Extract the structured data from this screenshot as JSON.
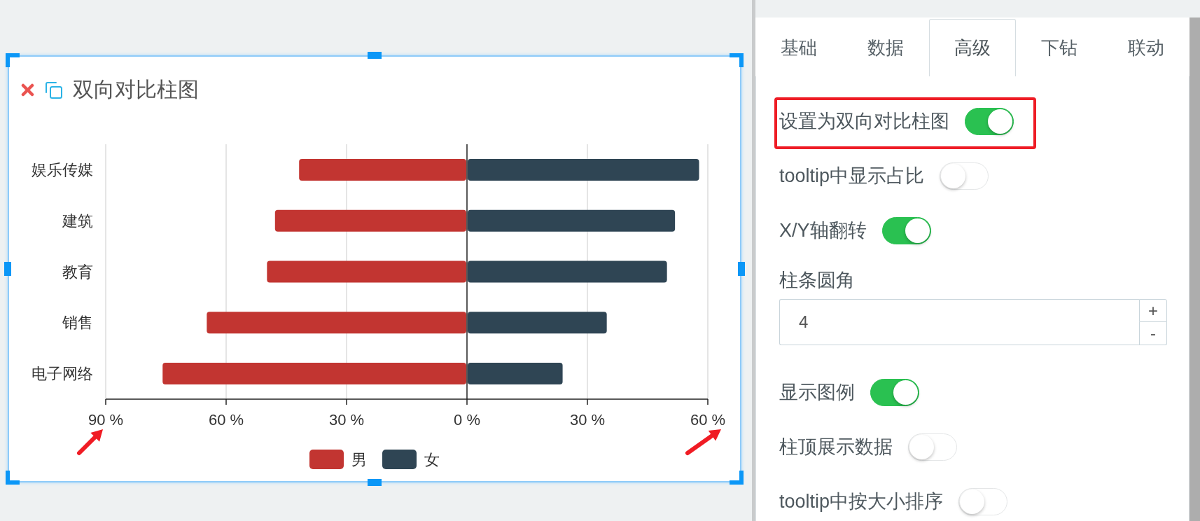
{
  "chart_widget": {
    "title": "双向对比柱图",
    "selected": true,
    "chart_data": {
      "type": "bar",
      "orientation": "horizontal",
      "stacked": true,
      "grid": true,
      "legend": true,
      "categories": [
        "娱乐传媒",
        "建筑",
        "教育",
        "销售",
        "电子网络"
      ],
      "series": [
        {
          "name": "男",
          "color": "#c23531",
          "values": [
            -42,
            -48,
            -50,
            -65,
            -76
          ]
        },
        {
          "name": "女",
          "color": "#2f4554",
          "values": [
            58,
            52,
            50,
            35,
            24
          ]
        }
      ],
      "xlim": [
        -90,
        60
      ],
      "xticks": [
        {
          "value": -90,
          "label": "90 %"
        },
        {
          "value": -60,
          "label": "60 %"
        },
        {
          "value": -30,
          "label": "30 %"
        },
        {
          "value": 0,
          "label": "0 %"
        },
        {
          "value": 30,
          "label": "30 %"
        },
        {
          "value": 60,
          "label": "60 %"
        }
      ]
    }
  },
  "settings_panel": {
    "tabs": [
      {
        "label": "基础",
        "selected": false
      },
      {
        "label": "数据",
        "selected": false
      },
      {
        "label": "高级",
        "selected": true
      },
      {
        "label": "下钻",
        "selected": false
      },
      {
        "label": "联动",
        "selected": false
      }
    ],
    "settings": [
      {
        "kind": "toggle",
        "label": "设置为双向对比柱图",
        "on": true,
        "highlighted": true
      },
      {
        "kind": "toggle",
        "label": "tooltip中显示占比",
        "on": false,
        "highlighted": false
      },
      {
        "kind": "toggle",
        "label": "X/Y轴翻转",
        "on": true,
        "highlighted": false
      },
      {
        "kind": "number",
        "label": "柱条圆角",
        "value": "4",
        "increment": "+",
        "decrement": "-",
        "highlighted": false
      },
      {
        "kind": "toggle",
        "label": "显示图例",
        "on": true,
        "highlighted": false
      },
      {
        "kind": "toggle",
        "label": "柱顶展示数据",
        "on": false,
        "highlighted": false
      },
      {
        "kind": "toggle",
        "label": "tooltip中按大小排序",
        "on": false,
        "highlighted": false
      }
    ]
  }
}
